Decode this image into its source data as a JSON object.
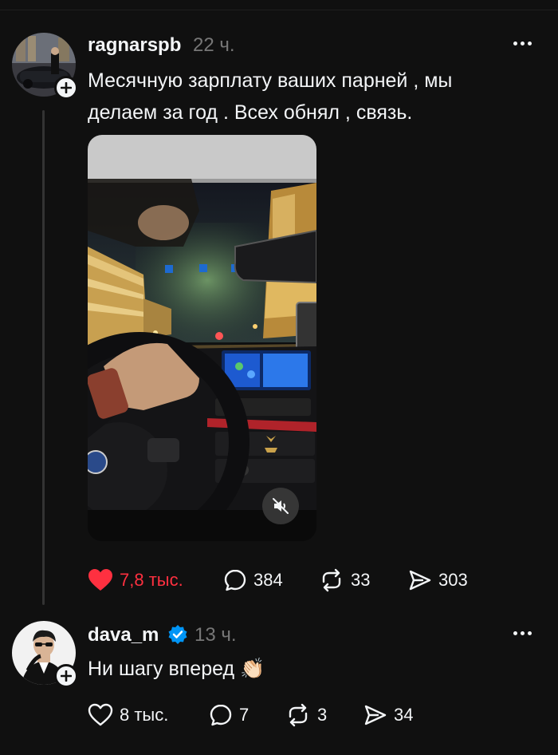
{
  "posts": [
    {
      "username": "ragnarspb",
      "time": "22 ч.",
      "text_line1": "Месячную зарплату ваших парней , мы",
      "text_line2": "делаем за год . Всех обнял , связь.",
      "likes": "7,8 тыс.",
      "comments": "384",
      "reposts": "33",
      "shares": "303",
      "liked": true
    },
    {
      "username": "dava_m",
      "time": "13 ч.",
      "text": "Ни шагу вперед",
      "emoji": "👏🏻",
      "verified": true,
      "likes": "8 тыс.",
      "comments": "7",
      "reposts": "3",
      "shares": "34",
      "liked": false
    }
  ],
  "colors": {
    "background": "#101010",
    "like_red": "#ff3040",
    "verified_blue": "#0095f6",
    "muted_text": "#777777"
  },
  "icons": [
    "plus-icon",
    "more-icon",
    "heart-icon",
    "comment-icon",
    "repost-icon",
    "share-icon",
    "mute-icon",
    "verified-icon"
  ]
}
